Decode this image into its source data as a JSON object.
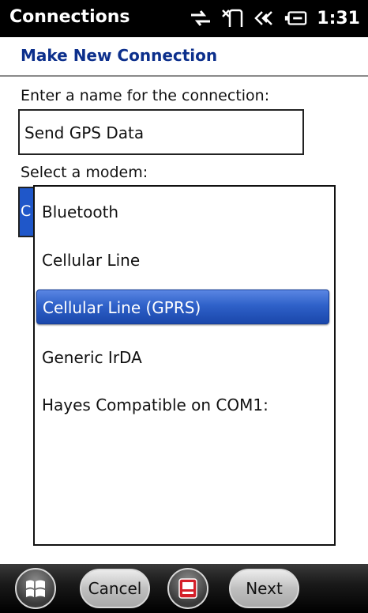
{
  "titlebar": {
    "title": "Connections",
    "time": "1:31"
  },
  "header": {
    "title": "Make New Connection"
  },
  "form": {
    "name_label": "Enter a name for the connection:",
    "name_value": "Send GPS Data",
    "modem_label": "Select a modem:",
    "modem_selected_visible": "C"
  },
  "dropdown": {
    "options": [
      {
        "label": "Bluetooth"
      },
      {
        "label": "Cellular Line"
      },
      {
        "label": "Cellular Line (GPRS)",
        "selected": true
      },
      {
        "label": "Generic IrDA"
      },
      {
        "label": "Hayes Compatible on COM1:"
      }
    ]
  },
  "bottombar": {
    "cancel_label": "Cancel",
    "next_label": "Next"
  },
  "colors": {
    "accent": "#1f57c9",
    "header_text": "#0c2f8c"
  }
}
